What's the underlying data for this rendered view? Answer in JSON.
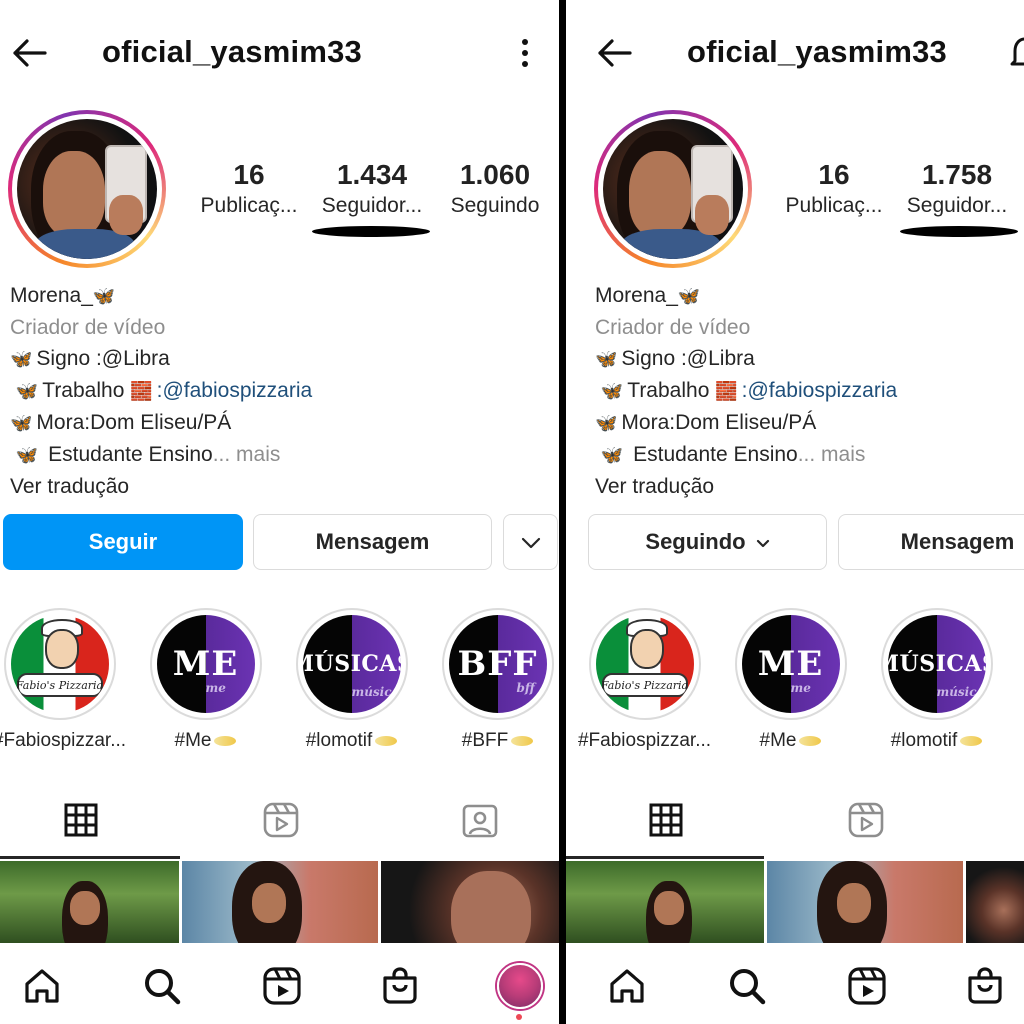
{
  "colors": {
    "accent": "#0095f6",
    "link": "#1f4f7a",
    "muted": "#8e8e8e",
    "notification": "#ed4956"
  },
  "left": {
    "header": {
      "username": "oficial_yasmim33",
      "back_icon": "arrow-left-icon",
      "menu_icon": "kebab-menu-icon"
    },
    "stats": {
      "posts": {
        "value": "16",
        "label": "Publicaç..."
      },
      "followers": {
        "value": "1.434",
        "label": "Seguidor..."
      },
      "following": {
        "value": "1.060",
        "label": "Seguindo"
      }
    },
    "bio": {
      "name": "Morena_",
      "category": "Criador de vídeo",
      "line1": "Signo :@Libra",
      "line2_text": "Trabalho ",
      "line2_link": ":@fabiospizzaria",
      "line3": "Mora:Dom Eliseu/PÁ",
      "line4": " Estudante Ensino",
      "more": "... mais",
      "translate": "Ver tradução"
    },
    "buttons": {
      "follow": "Seguir",
      "message": "Mensagem"
    },
    "highlights": [
      {
        "label": "#Fabiospizzar...",
        "title": "Fabio's Pizzaria"
      },
      {
        "label": "#Me",
        "title": "ME",
        "subtitle": "me"
      },
      {
        "label": "#lomotif",
        "title": "MÚSICAS",
        "subtitle": "músicas"
      },
      {
        "label": "#BFF",
        "title": "BFF",
        "subtitle": "bff"
      }
    ]
  },
  "right": {
    "header": {
      "username": "oficial_yasmim33",
      "back_icon": "arrow-left-icon",
      "bell_icon": "bell-icon"
    },
    "stats": {
      "posts": {
        "value": "16",
        "label": "Publicaç..."
      },
      "followers": {
        "value": "1.758",
        "label": "Seguidor..."
      }
    },
    "bio": {
      "name": "Morena_",
      "category": "Criador de vídeo",
      "line1": "Signo :@Libra",
      "line2_text": "Trabalho ",
      "line2_link": ":@fabiospizzaria",
      "line3": "Mora:Dom Eliseu/PÁ",
      "line4": " Estudante Ensino",
      "more": "... mais",
      "translate": "Ver tradução"
    },
    "buttons": {
      "following": "Seguindo",
      "message": "Mensagem"
    },
    "highlights": [
      {
        "label": "#Fabiospizzar...",
        "title": "Fabio's Pizzaria"
      },
      {
        "label": "#Me",
        "title": "ME",
        "subtitle": "me"
      },
      {
        "label": "#lomotif",
        "title": "MÚSICAS",
        "subtitle": "músicas"
      }
    ]
  },
  "emoji": {
    "butterfly": "🦋",
    "box": "🧱"
  },
  "icons": [
    "home-icon",
    "search-icon",
    "reels-icon",
    "shop-icon",
    "profile-avatar",
    "grid-icon",
    "reels-tab-icon",
    "tagged-icon",
    "chevron-down-icon"
  ]
}
